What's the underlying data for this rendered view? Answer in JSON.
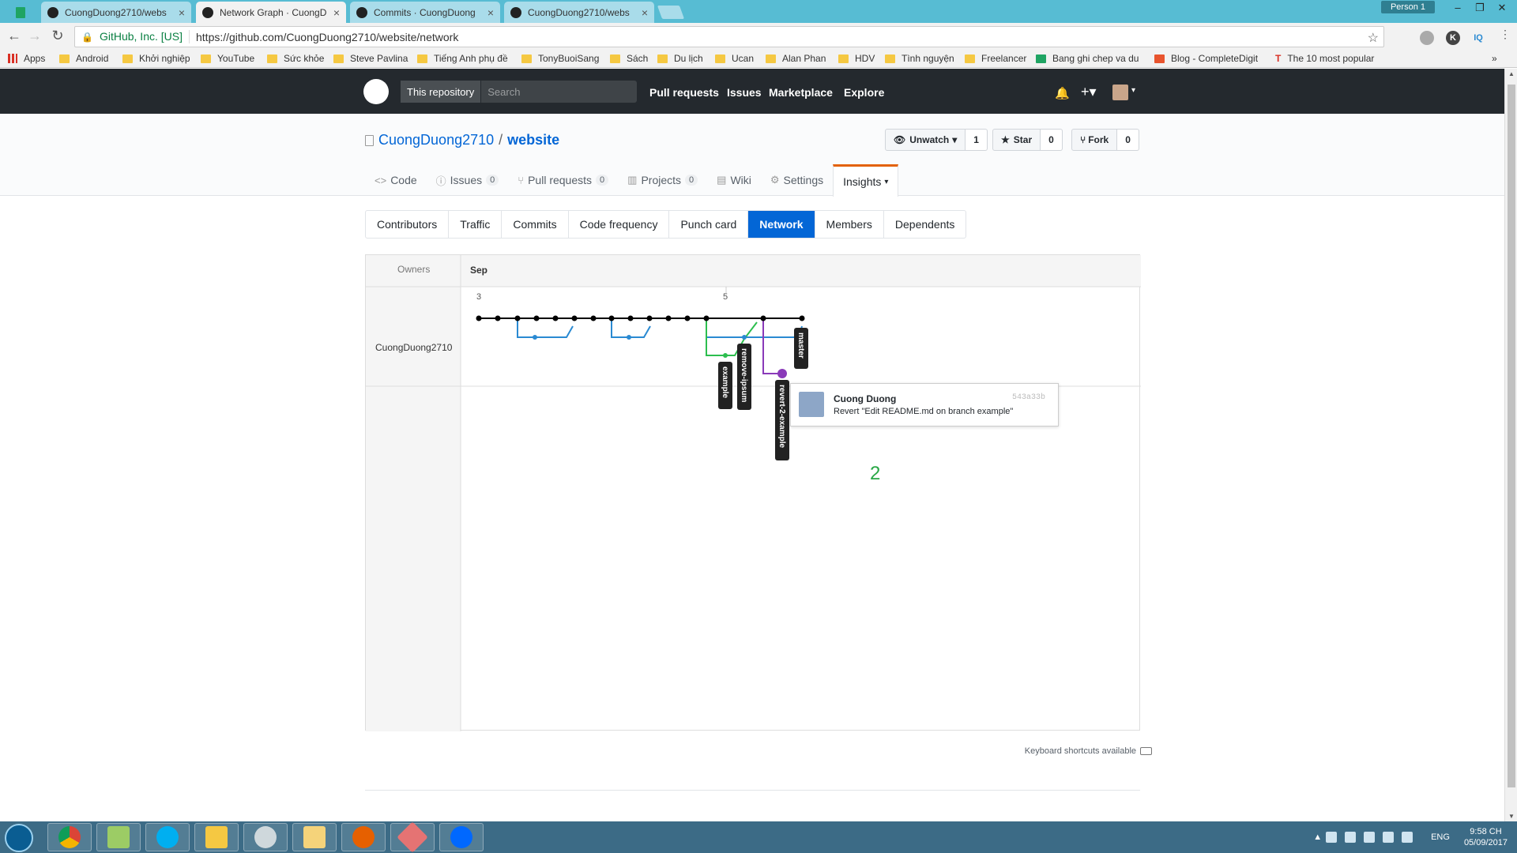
{
  "browser": {
    "tabs": [
      {
        "label": "CuongDuong2710/webs",
        "active": false
      },
      {
        "label": "Network Graph · CuongD",
        "active": true
      },
      {
        "label": "Commits · CuongDuong",
        "active": false
      },
      {
        "label": "CuongDuong2710/webs",
        "active": false
      }
    ],
    "profile": "Person 1",
    "secure_label": "GitHub, Inc. [US]",
    "url": "https://github.com/CuongDuong2710/website/network",
    "bookmarks": [
      "Apps",
      "Android",
      "Khởi nghiệp",
      "YouTube",
      "Sức khỏe",
      "Steve Pavlina",
      "Tiếng Anh phụ đề",
      "TonyBuoiSang",
      "Sách",
      "Du lịch",
      "Ucan",
      "Alan Phan",
      "HDV",
      "Tình nguyện",
      "Freelancer",
      "Bang ghi chep va du",
      "Blog - CompleteDigit",
      "The 10 most popular"
    ]
  },
  "github_header": {
    "scope": "This repository",
    "search_placeholder": "Search",
    "links": [
      "Pull requests",
      "Issues",
      "Marketplace",
      "Explore"
    ]
  },
  "repo": {
    "owner": "CuongDuong2710",
    "separator": "/",
    "name": "website",
    "unwatch_label": "Unwatch",
    "unwatch_count": "1",
    "star_label": "Star",
    "star_count": "0",
    "fork_label": "Fork",
    "fork_count": "0",
    "nav": [
      {
        "label": "Code",
        "count": null
      },
      {
        "label": "Issues",
        "count": "0"
      },
      {
        "label": "Pull requests",
        "count": "0"
      },
      {
        "label": "Projects",
        "count": "0"
      },
      {
        "label": "Wiki",
        "count": null
      },
      {
        "label": "Settings",
        "count": null
      },
      {
        "label": "Insights",
        "count": null
      }
    ]
  },
  "insights_nav": [
    "Contributors",
    "Traffic",
    "Commits",
    "Code frequency",
    "Punch card",
    "Network",
    "Members",
    "Dependents"
  ],
  "network": {
    "owners_header": "Owners",
    "month": "Sep",
    "owner_name": "CuongDuong2710",
    "day_labels": [
      "3",
      "5"
    ],
    "branches": [
      "master",
      "example",
      "remove-ipsum",
      "revert-2-example"
    ],
    "colors": {
      "master": "#000000",
      "feature": "#2a8ad2",
      "example": "#2cbe4e",
      "revert": "#8a3ab9"
    },
    "tooltip": {
      "author": "Cuong Duong",
      "sha": "543a33b",
      "message": "Revert \"Edit README.md on branch example\""
    },
    "annotation": "2"
  },
  "footer": {
    "keyboard": "Keyboard shortcuts available"
  },
  "taskbar": {
    "lang": "ENG",
    "time": "9:58 CH",
    "date": "05/09/2017"
  }
}
